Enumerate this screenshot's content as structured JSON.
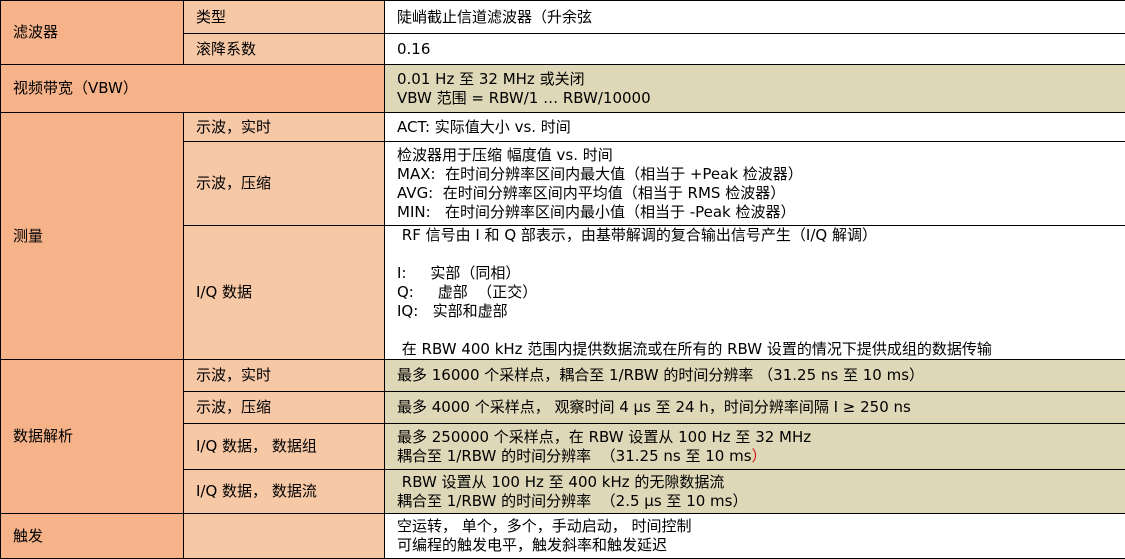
{
  "colors": {
    "category_bg": "#f6b38a",
    "subcategory_bg": "#f6c8a6",
    "value_bg_shaded": "#ded8b8",
    "value_bg_plain": "#ffffff",
    "accent_red": "#d01010"
  },
  "rows": {
    "filter": {
      "category": "滤波器",
      "type_label": "类型",
      "type_value": "陡峭截止信道滤波器（升余弦",
      "rolloff_label": "滚降系数",
      "rolloff_value": "0.16"
    },
    "vbw": {
      "category": "视频带宽（VBW）",
      "line1": "0.01 Hz 至 32 MHz 或关闭",
      "line2": "VBW 范围 = RBW/1 … RBW/10000"
    },
    "measurement": {
      "category": "测量",
      "realtime_label": "示波，实时",
      "realtime_value": "ACT:  实际值大小 vs. 时间",
      "compressed_label": "示波，压缩",
      "compressed_lines": [
        "检波器用于压缩 幅度值 vs. 时间",
        "MAX:  在时间分辨率区间内最大值（相当于 +Peak 检波器）",
        "AVG:  在时间分辨率区间内平均值（相当于 RMS 检波器）",
        "MIN:   在时间分辨率区间内最小值（相当于 -Peak 检波器）"
      ],
      "iq_label": "I/Q 数据",
      "iq_intro": " RF 信号由 I 和 Q 部表示，由基带解调的复合输出信号产生（I/Q 解调）",
      "iq_i": "I:     实部（同相）",
      "iq_q": "Q:     虚部  （正交）",
      "iq_iq": "IQ:   实部和虚部",
      "iq_note": " 在 RBW 400 kHz 范围内提供数据流或在所有的 RBW 设置的情况下提供成组的数据传输"
    },
    "resolution": {
      "category": "数据解析",
      "realtime_label": "示波，实时",
      "realtime_value": "最多 16000 个采样点，耦合至 1/RBW 的时间分辨率 （31.25 ns 至 10 ms）",
      "compressed_label": "示波，压缩",
      "compressed_value": "最多 4000 个采样点， 观察时间 4 µs 至 24 h，时间分辨率间隔 I ≥ 250 ns",
      "iq_block_label": "I/Q 数据， 数据组",
      "iq_block_line1": "最多 250000 个采样点，在 RBW 设置从 100 Hz 至 32 MHz",
      "iq_block_line2": "耦合至 1/RBW 的时间分辨率  （31.25 ns 至 10 ms",
      "iq_block_line2_end": "）",
      "iq_stream_label": "I/Q 数据， 数据流",
      "iq_stream_line1": " RBW 设置从 100 Hz 至 400 kHz 的无隙数据流",
      "iq_stream_line2": "耦合至 1/RBW 的时间分辨率  （2.5 µs 至 10 ms）"
    },
    "trigger": {
      "category": "触发",
      "line1": "空运转， 单个，多个，手动启动， 时间控制",
      "line2": "可编程的触发电平，触发斜率和触发延迟"
    }
  }
}
